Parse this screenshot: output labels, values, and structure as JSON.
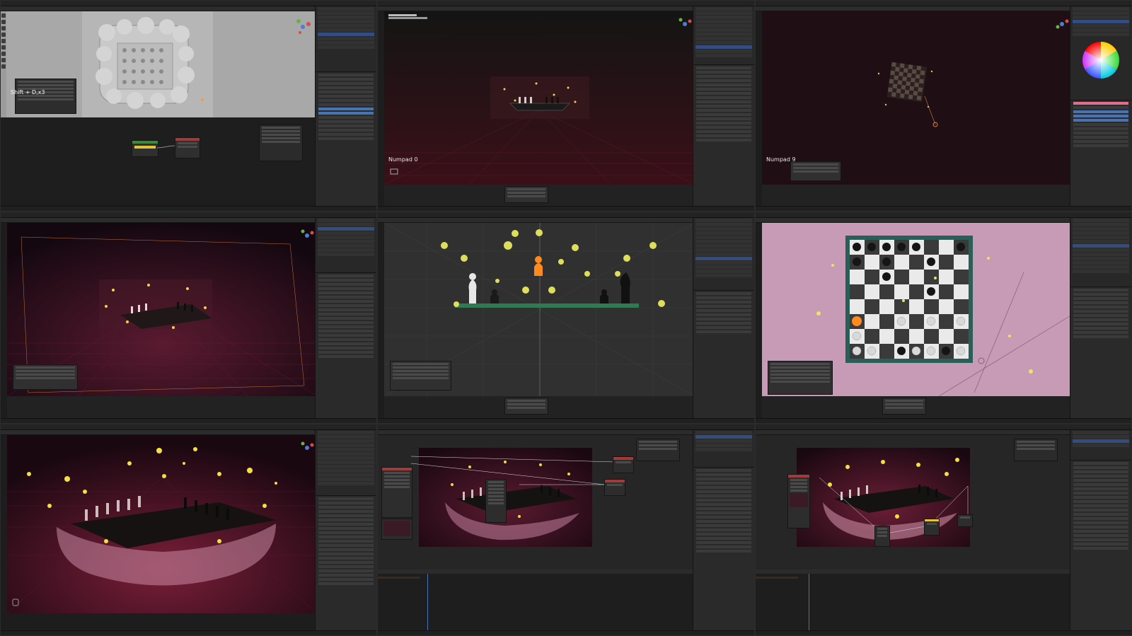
{
  "cells": {
    "c1": {
      "viewport_text": "Shift + D,x3",
      "colors": {
        "bg": "#a9a9a9",
        "node_editor": "#1e1e1e"
      }
    },
    "c2": {
      "viewport_text": "Numpad 0",
      "colors": {
        "bg": "#1a1010"
      }
    },
    "c3": {
      "viewport_text": "Numpad 9",
      "colors": {
        "bg": "#1f0e14"
      }
    },
    "c4": {
      "colors": {
        "bg": "#1b0a10"
      }
    },
    "c5": {
      "colors": {
        "bg": "#303030",
        "accent": "#ff8a1e",
        "shelf": "#2f7a50"
      }
    },
    "c6": {
      "colors": {
        "bg": "#c79ab5",
        "board_frame": "#2a5f58"
      }
    },
    "c7": {
      "colors": {
        "bg": "#220d15"
      }
    },
    "c8": {
      "colors": {
        "render": "#2a0f1a"
      }
    },
    "c9": {
      "colors": {
        "render": "#2a0f1a"
      }
    }
  },
  "icons": [
    "gizmo-icon",
    "camera-icon",
    "hand-icon",
    "color-wheel-icon"
  ]
}
